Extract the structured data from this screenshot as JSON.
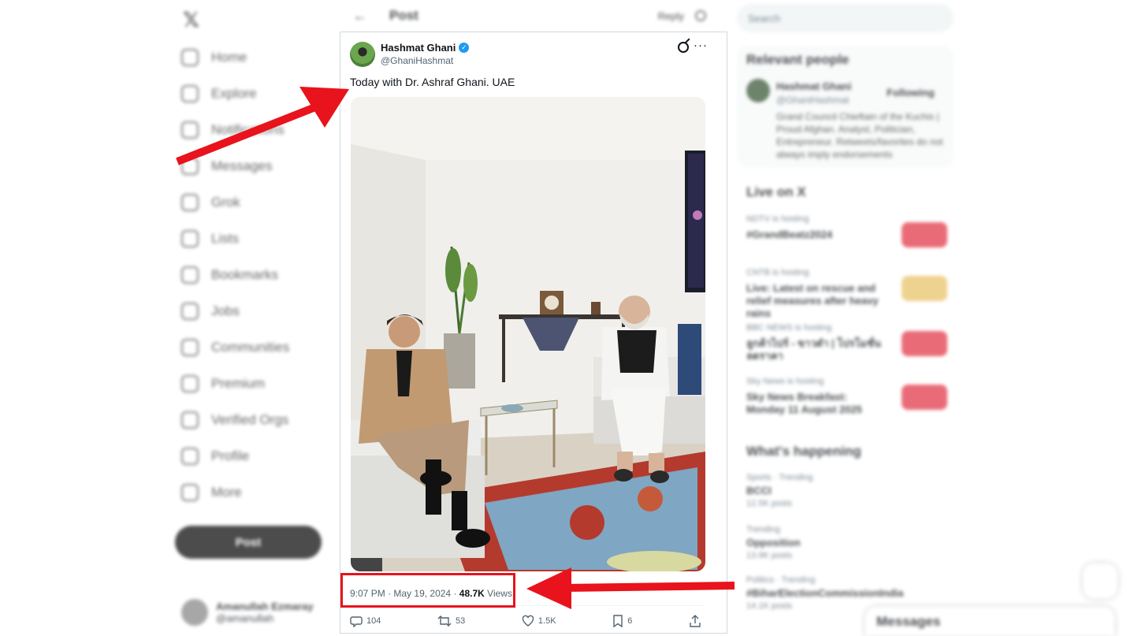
{
  "nav": {
    "items": [
      "Home",
      "Explore",
      "Notifications",
      "Messages",
      "Grok",
      "Lists",
      "Bookmarks",
      "Jobs",
      "Communities",
      "Premium",
      "Verified Orgs",
      "Profile",
      "More"
    ],
    "post_button": "Post",
    "account_name": "Amanullah Ezmaray",
    "account_handle": "@amanullah"
  },
  "header": {
    "title": "Post",
    "reply": "Reply"
  },
  "tweet": {
    "name": "Hashmat Ghani",
    "handle": "@GhaniHashmat",
    "text": "Today with Dr. Ashraf Ghani. UAE",
    "time": "9:07 PM",
    "date": "May 19, 2024",
    "views_count": "48.7K",
    "views_label": "Views",
    "replies": "104",
    "reposts": "53",
    "likes": "1.5K",
    "bookmarks": "6"
  },
  "right": {
    "search_placeholder": "Search",
    "relevant_title": "Relevant people",
    "person_name": "Hashmat Ghani",
    "person_handle": "@GhaniHashmat",
    "follow_label": "Following",
    "person_bio": "Grand Council Chieftain of the Kuchis | Proud Afghan. Analyst, Politician, Entrepreneur. Retweets/favorites do not always imply endorsements",
    "live_title": "Live on X",
    "live": [
      {
        "meta": "NDTV is hosting",
        "text": "#GrandBeatz2024"
      },
      {
        "meta": "CNTB is hosting",
        "text": "Live: Latest on rescue and relief measures after heavy rains"
      },
      {
        "meta": "BBC NEWS is hosting",
        "text": "ลูกค้าไปร์ - ขาวดำ | โปรโมชั่นลดราคา"
      },
      {
        "meta": "Sky News is hosting",
        "text": "Sky News Breakfast: Monday 11 August 2025"
      }
    ],
    "happening_title": "What's happening",
    "trends": [
      {
        "meta": "Sports · Trending",
        "topic": "BCCI",
        "count": "12.5K posts"
      },
      {
        "meta": "Trending",
        "topic": "Opposition",
        "count": "13.9K posts"
      },
      {
        "meta": "Politics · Trending",
        "topic": "#BiharElectionCommissionIndia",
        "count": "14.1K posts"
      }
    ],
    "messages_label": "Messages"
  },
  "colors": {
    "annotation": "#e8131c",
    "verified": "#1d9bf0"
  }
}
